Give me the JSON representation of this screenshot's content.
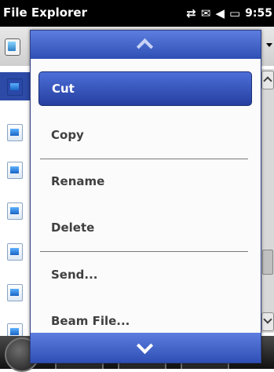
{
  "titlebar": {
    "title": "File Explorer",
    "clock": "9:55",
    "icons": [
      "connectivity-icon",
      "signal-icon",
      "volume-icon",
      "battery-icon"
    ]
  },
  "menu": {
    "items": [
      {
        "label": "Cut",
        "highlighted": true
      },
      {
        "label": "Copy",
        "highlighted": false
      },
      {
        "label": "Rename",
        "highlighted": false
      },
      {
        "label": "Delete",
        "highlighted": false
      },
      {
        "label": "Send...",
        "highlighted": false
      },
      {
        "label": "Beam File...",
        "highlighted": false
      }
    ]
  },
  "colors": {
    "menu_accent": "#2f4fb4",
    "highlight": "#3a5cc6",
    "titlebar": "#000000"
  }
}
